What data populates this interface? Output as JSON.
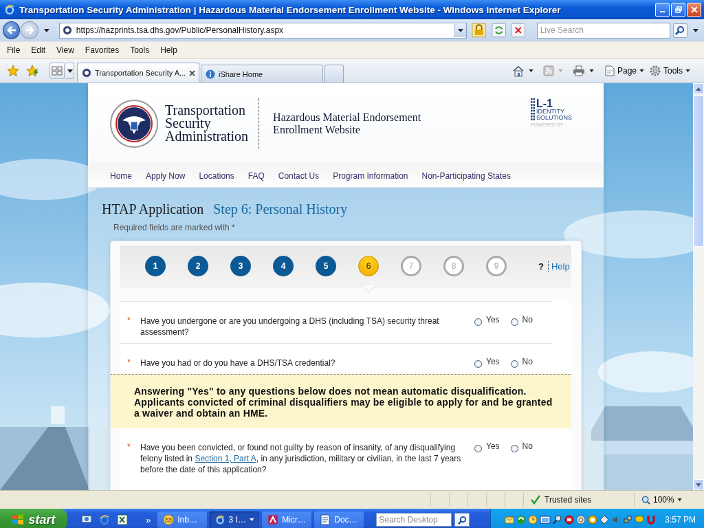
{
  "window": {
    "title": "Transportation Security Administration | Hazardous Material Endorsement Enrollment Website - Windows Internet Explorer"
  },
  "address_bar": {
    "url": "https://hazprints.tsa.dhs.gov/Public/PersonalHistory.aspx",
    "search_placeholder": "Live Search"
  },
  "menu": [
    "File",
    "Edit",
    "View",
    "Favorites",
    "Tools",
    "Help"
  ],
  "tabs": [
    {
      "label": "Transportation Security A...",
      "selected": true,
      "kind": "site"
    },
    {
      "label": "iShare Home",
      "selected": false,
      "kind": "info"
    },
    {
      "selected": false,
      "kind": "new"
    }
  ],
  "command_bar": [
    {
      "label": "Page",
      "kind": "page"
    },
    {
      "label": "Tools",
      "kind": "tools"
    }
  ],
  "site": {
    "agency": [
      "Transportation",
      "Security",
      "Administration"
    ],
    "site_title": [
      "Hazardous Material Endorsement",
      "Enrollment Website"
    ],
    "partner": {
      "mark": "L-1",
      "lines": [
        "IDENTITY",
        "SOLUTIONS"
      ],
      "powered": "POWERED BY"
    }
  },
  "nav": [
    "Home",
    "Apply Now",
    "Locations",
    "FAQ",
    "Contact Us",
    "Program Information",
    "Non-Participating States"
  ],
  "heading": {
    "title": "HTAP Application",
    "step": "Step 6: Personal History",
    "note": "Required fields are marked with *"
  },
  "steps": [
    {
      "label": "1",
      "completed": true,
      "selected": false
    },
    {
      "label": "2",
      "completed": true,
      "selected": false
    },
    {
      "label": "3",
      "completed": true,
      "selected": false
    },
    {
      "label": "4",
      "completed": true,
      "selected": false
    },
    {
      "label": "5",
      "completed": true,
      "selected": false
    },
    {
      "label": "6",
      "completed": false,
      "selected": true
    },
    {
      "label": "7",
      "completed": false,
      "selected": false
    },
    {
      "label": "8",
      "completed": false,
      "selected": false
    },
    {
      "label": "9",
      "completed": false,
      "selected": false
    }
  ],
  "help": {
    "mark": "?",
    "label": "Help"
  },
  "questions": [
    {
      "kind": "question",
      "mark": "*",
      "text": "Have you undergone or are you undergoing a DHS (including TSA) security threat assessment?",
      "options": [
        {
          "label": "Yes",
          "selected": false
        },
        {
          "label": "No",
          "selected": false
        }
      ]
    },
    {
      "kind": "question",
      "mark": "*",
      "text": "Have you had or do you have a DHS/TSA credential?",
      "options": [
        {
          "label": "Yes",
          "selected": false
        },
        {
          "label": "No",
          "selected": false
        }
      ]
    },
    {
      "kind": "notice",
      "text": "Answering \"Yes\" to any questions below does not mean automatic disqualification. Applicants convicted of criminal disqualifiers may be eligible to apply for and be granted a waiver and obtain an HME."
    },
    {
      "kind": "question",
      "mark": "*",
      "text": "Have you been convicted, or found not guilty by reason of insanity, of any disqualifying felony listed in ",
      "link": "Section 1, Part A",
      "text_after": ", in any jurisdiction, military or civilian, in the last 7 years before the date of this application?",
      "options": [
        {
          "label": "Yes",
          "selected": false
        },
        {
          "label": "No",
          "selected": false
        }
      ]
    }
  ],
  "status_bar": {
    "zone": "Trusted sites",
    "zoom": "100%"
  },
  "taskbar": {
    "start": "start",
    "more": "»",
    "tasks": [
      {
        "label": "Inb…",
        "kind": "mail",
        "selected": false
      },
      {
        "label": "3 I…",
        "kind": "browser",
        "selected": true
      },
      {
        "label": "Micr…",
        "kind": "app",
        "selected": false
      },
      {
        "label": "Doc…",
        "kind": "doc",
        "selected": false
      }
    ],
    "search_placeholder": "Search Desktop",
    "clock": "3:57 PM"
  }
}
